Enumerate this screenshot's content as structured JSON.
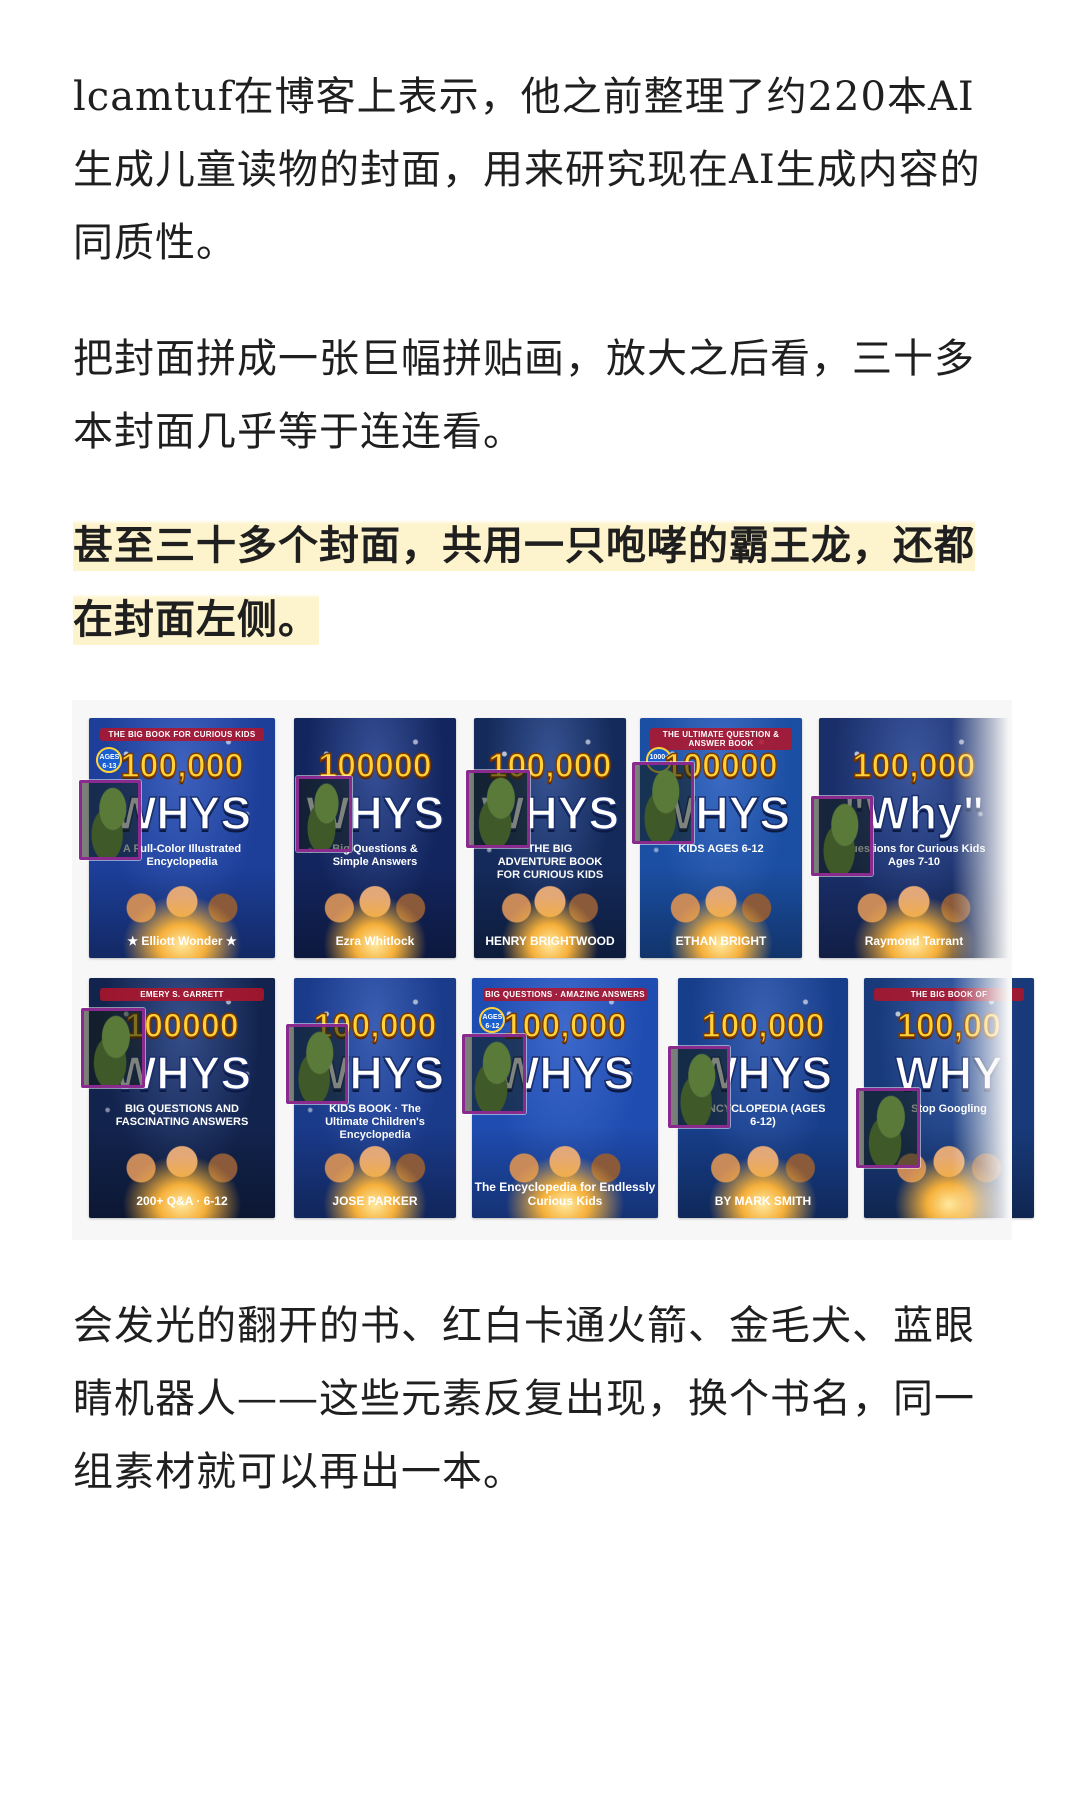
{
  "article": {
    "paragraph1_lines": [
      "lcamtuf在博客上表示，他之前整理了约220本AI",
      "生成儿童读物的封面，用来研究现在AI生成内容的",
      "同质性。"
    ],
    "paragraph2_lines": [
      "把封面拼成一张巨幅拼贴画，放大之后看，三十多",
      "本封面几乎等于连连看。"
    ],
    "highlight_lines": [
      "甚至三十多个封面，共用一只咆哮的霸王龙，还都",
      "在封面左侧。"
    ],
    "paragraph3_lines": [
      "会发光的翻开的书、红白卡通火箭、金毛犬、蓝眼",
      "睛机器人——这些元素反复出现，换个书名，同一",
      "组素材就可以再出一本。"
    ]
  },
  "collage": {
    "highlight_color": "#fdf3cc",
    "marker_color": "#8a2a8f",
    "covers": [
      {
        "top": "THE BIG BOOK FOR CURIOUS KIDS",
        "badge": "AGES 6-13",
        "num": "100,000",
        "word": "WHYS",
        "sub": "A Full-Color Illustrated Encyclopedia",
        "author": "★ Elliott Wonder ★",
        "bg": "#1d3f9a"
      },
      {
        "top": "",
        "badge": "",
        "num": "100000",
        "word": "WHYS",
        "sub": "Big Questions & Simple Answers",
        "author": "Ezra Whitlock",
        "bg": "#13255e"
      },
      {
        "top": "",
        "badge": "",
        "num": "100,000",
        "word": "WHYS",
        "sub": "THE BIG ADVENTURE BOOK FOR CURIOUS KIDS",
        "author": "HENRY BRIGHTWOOD",
        "bg": "#142a5a"
      },
      {
        "top": "THE ULTIMATE QUESTION & ANSWER BOOK",
        "badge": "1000+",
        "num": "100000",
        "word": "WHYS",
        "sub": "KIDS AGES 6-12",
        "author": "ETHAN BRIGHT",
        "bg": "#1b4fa3"
      },
      {
        "top": "",
        "badge": "",
        "num": "100,000",
        "word": "\"Why\"",
        "sub": "Questions for Curious Kids Ages 7-10",
        "author": "Raymond Tarrant",
        "bg": "#1a2f6a"
      },
      {
        "top": "EMERY S. GARRETT",
        "badge": "",
        "num": "100000",
        "word": "WHYS",
        "sub": "BIG QUESTIONS AND FASCINATING ANSWERS",
        "author": "200+ Q&A · 6-12",
        "bg": "#12234d"
      },
      {
        "top": "",
        "badge": "",
        "num": "100,000",
        "word": "WHYS",
        "sub": "KIDS BOOK · The Ultimate Children's Encyclopedia",
        "author": "JOSE PARKER",
        "bg": "#1a3a8a"
      },
      {
        "top": "BIG QUESTIONS · AMAZING ANSWERS",
        "badge": "AGES 6-12",
        "num": "100,000",
        "word": "WHYS",
        "sub": "",
        "author": "The Encyclopedia for Endlessly Curious Kids",
        "bg": "#1f4cb0"
      },
      {
        "top": "",
        "badge": "",
        "num": "100,000",
        "word": "WHYS",
        "sub": "ENCYCLOPEDIA (AGES 6-12)",
        "author": "BY MARK SMITH",
        "bg": "#173e8a"
      },
      {
        "top": "THE BIG BOOK OF",
        "badge": "",
        "num": "100,00",
        "word": "WHY",
        "sub": "Stop Googling",
        "author": "",
        "bg": "#183a7a"
      }
    ]
  }
}
